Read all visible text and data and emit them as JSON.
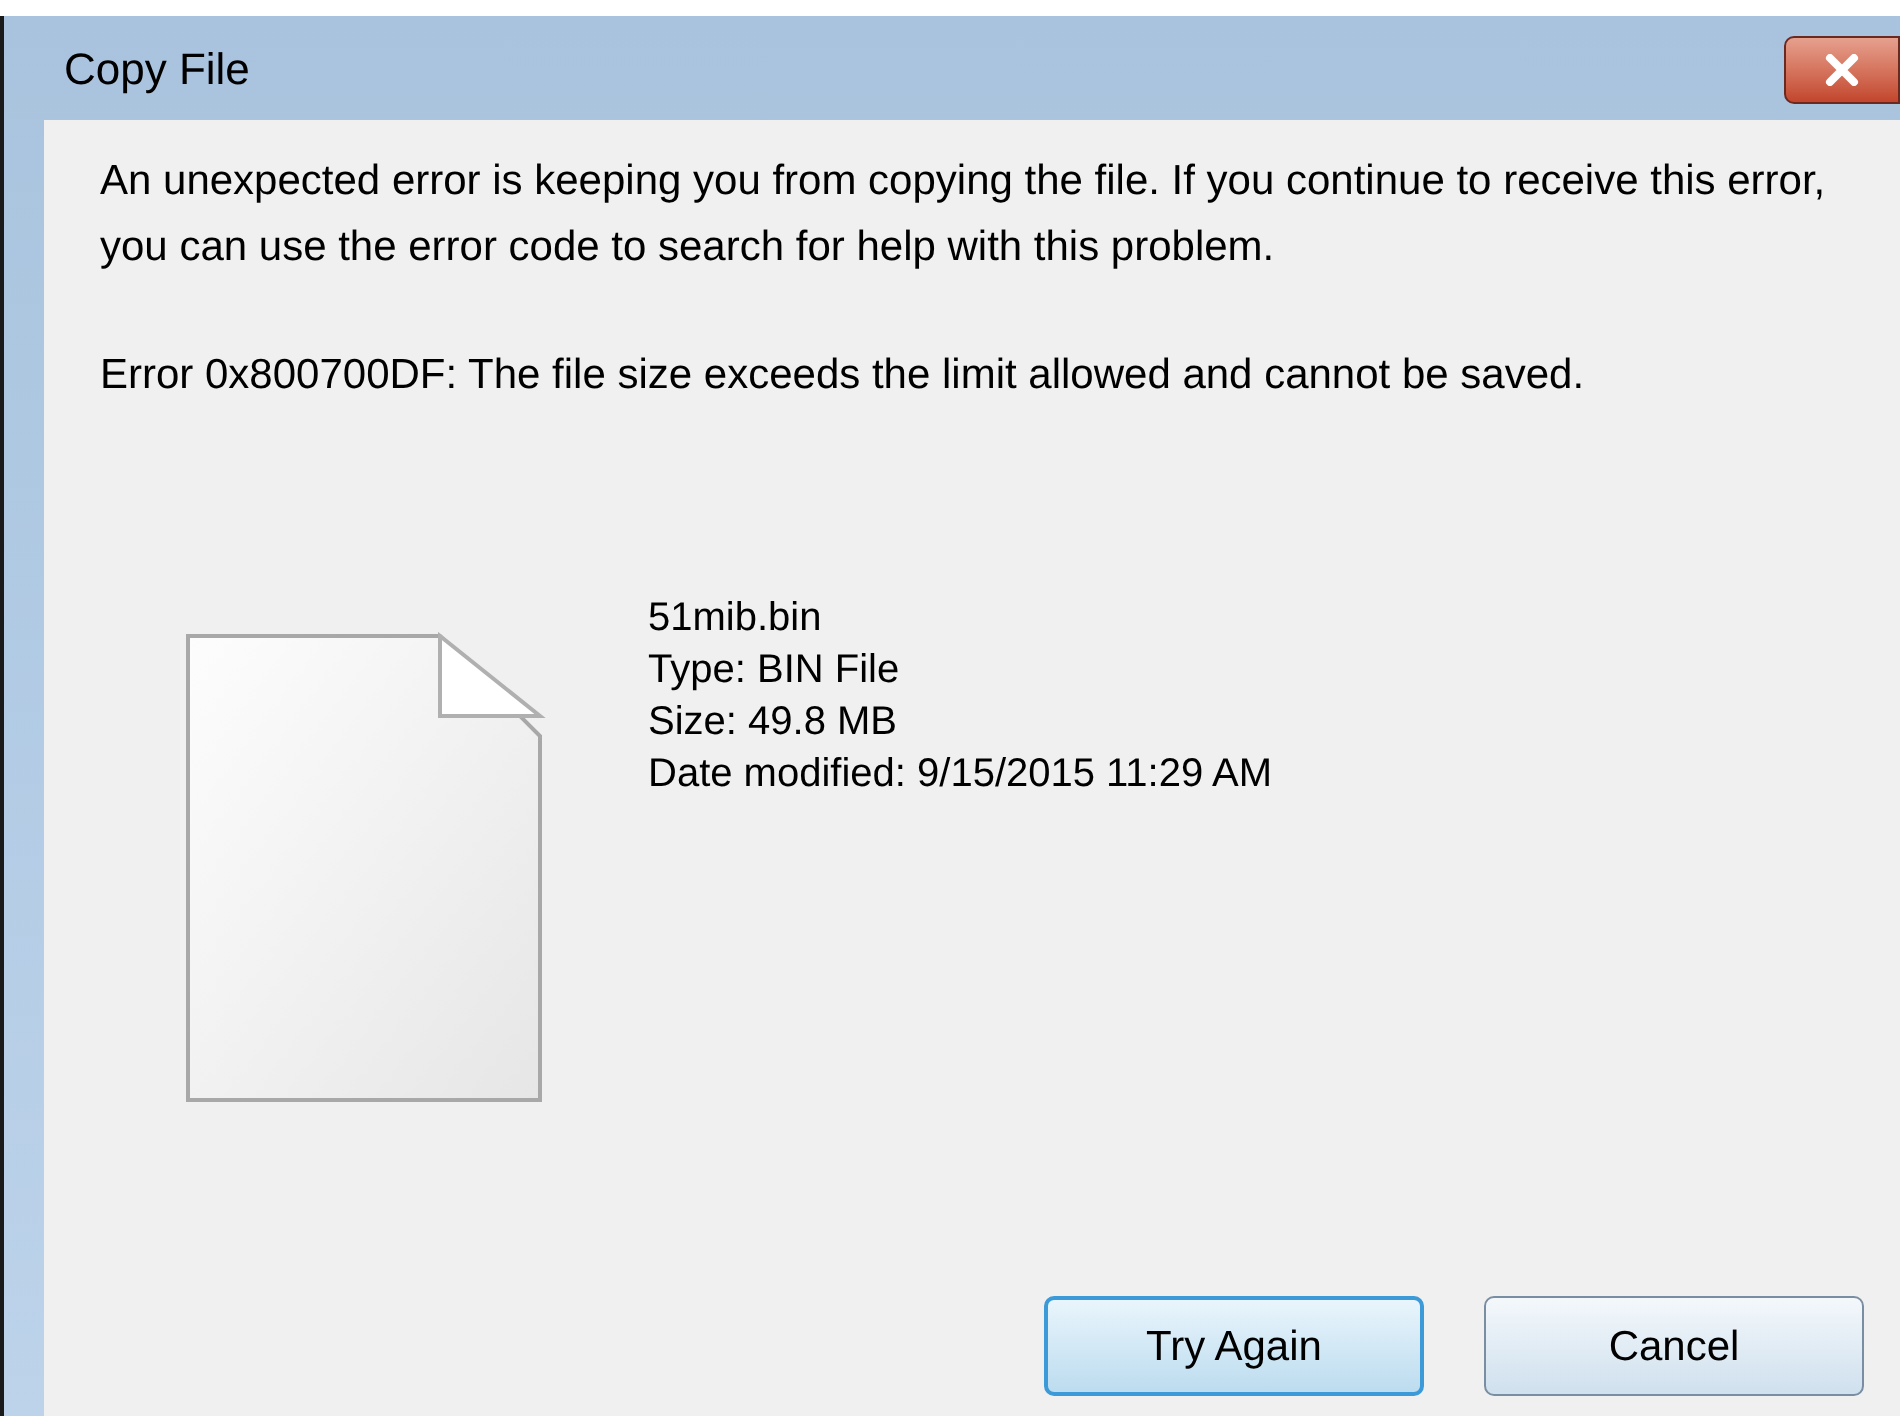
{
  "window": {
    "title": "Copy File"
  },
  "message": "An unexpected error is keeping you from copying the file. If you continue to receive this error, you can use the error code to search for help with this problem.",
  "error": "Error 0x800700DF: The file size exceeds the limit allowed and cannot be saved.",
  "file": {
    "name": "51mib.bin",
    "details": [
      "Type: BIN File",
      "Size: 49.8 MB",
      "Date modified: 9/15/2015 11:29 AM"
    ]
  },
  "buttons": [
    {
      "label": "Try Again",
      "default": true
    },
    {
      "label": "Cancel",
      "default": false
    }
  ]
}
